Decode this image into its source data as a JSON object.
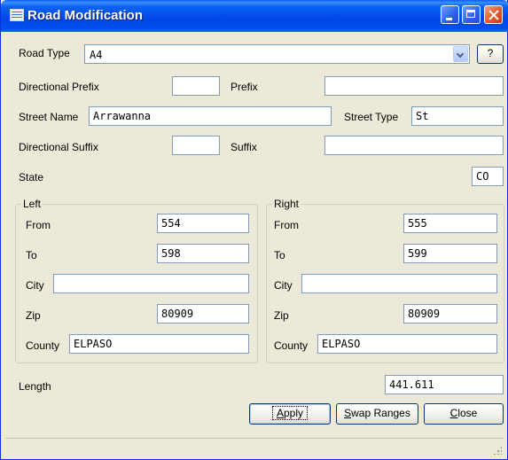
{
  "window": {
    "title": "Road Modification"
  },
  "road_type": {
    "label": "Road Type",
    "value": "A4",
    "help_label": "?"
  },
  "directional_prefix": {
    "label": "Directional Prefix",
    "value": ""
  },
  "prefix": {
    "label": "Prefix",
    "value": ""
  },
  "street_name": {
    "label": "Street Name",
    "value": "Arrawanna"
  },
  "street_type": {
    "label": "Street Type",
    "value": "St"
  },
  "directional_suffix": {
    "label": "Directional Suffix",
    "value": ""
  },
  "suffix": {
    "label": "Suffix",
    "value": ""
  },
  "state": {
    "label": "State",
    "value": "CO"
  },
  "left": {
    "title": "Left",
    "from_label": "From",
    "from": "554",
    "to_label": "To",
    "to": "598",
    "city_label": "City",
    "city": "",
    "zip_label": "Zip",
    "zip": "80909",
    "county_label": "County",
    "county": "ELPASO"
  },
  "right": {
    "title": "Right",
    "from_label": "From",
    "from": "555",
    "to_label": "To",
    "to": "599",
    "city_label": "City",
    "city": "",
    "zip_label": "Zip",
    "zip": "80909",
    "county_label": "County",
    "county": "ELPASO"
  },
  "length": {
    "label": "Length",
    "value": "441.611"
  },
  "buttons": {
    "apply_mnemonic": "A",
    "apply_rest": "pply",
    "swap_mnemonic": "S",
    "swap_rest": "wap Ranges",
    "close_mnemonic": "C",
    "close_rest": "lose"
  }
}
